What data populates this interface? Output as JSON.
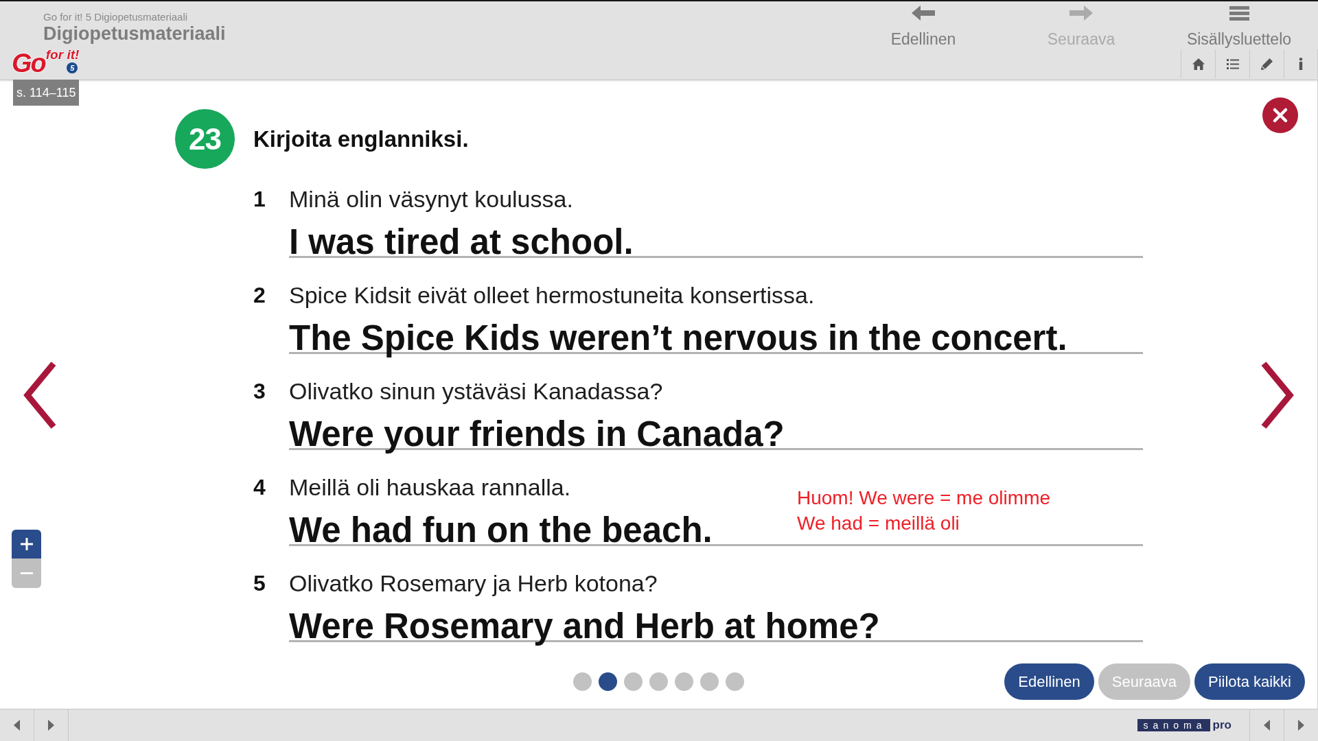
{
  "header": {
    "subtitle": "Go for it! 5 Digiopetusmateriaali",
    "title": "Digiopetusmateriaali",
    "logo": {
      "main": "Go",
      "tagline": "for it!",
      "edition": "5"
    },
    "nav": [
      {
        "kind": "back",
        "label": "Edellinen",
        "disabled": false
      },
      {
        "kind": "forward",
        "label": "Seuraava",
        "disabled": true
      },
      {
        "kind": "contents",
        "label": "Sisällysluettelo",
        "disabled": false
      }
    ]
  },
  "page_label": "s. 114–115",
  "exercise": {
    "number": "23",
    "title": "Kirjoita englanniksi.",
    "items": [
      {
        "number": "1",
        "question": "Minä olin väsynyt koulussa.",
        "answer": "I was tired at school."
      },
      {
        "number": "2",
        "question": "Spice Kidsit eivät olleet hermostuneita konsertissa.",
        "answer": "The Spice Kids weren’t nervous in the concert."
      },
      {
        "number": "3",
        "question": "Olivatko sinun ystäväsi Kanadassa?",
        "answer": "Were your friends in Canada?"
      },
      {
        "number": "4",
        "question": "Meillä oli hauskaa rannalla.",
        "answer": "We had fun on the beach.",
        "note_lines": [
          "Huom! We were = me olimme",
          "We had = meillä oli"
        ]
      },
      {
        "number": "5",
        "question": "Olivatko Rosemary ja Herb kotona?",
        "answer": "Were Rosemary and Herb at home?"
      }
    ]
  },
  "pagination": [
    {
      "selected": false
    },
    {
      "selected": true
    },
    {
      "selected": false
    },
    {
      "selected": false
    },
    {
      "selected": false
    },
    {
      "selected": false
    },
    {
      "selected": false
    }
  ],
  "buttons": [
    {
      "label": "Edellinen",
      "disabled": false
    },
    {
      "label": "Seuraava",
      "disabled": true
    },
    {
      "label": "Piilota kaikki",
      "disabled": false
    }
  ],
  "footer": {
    "logo": {
      "name": "sanoma",
      "suffix": "pro"
    }
  }
}
